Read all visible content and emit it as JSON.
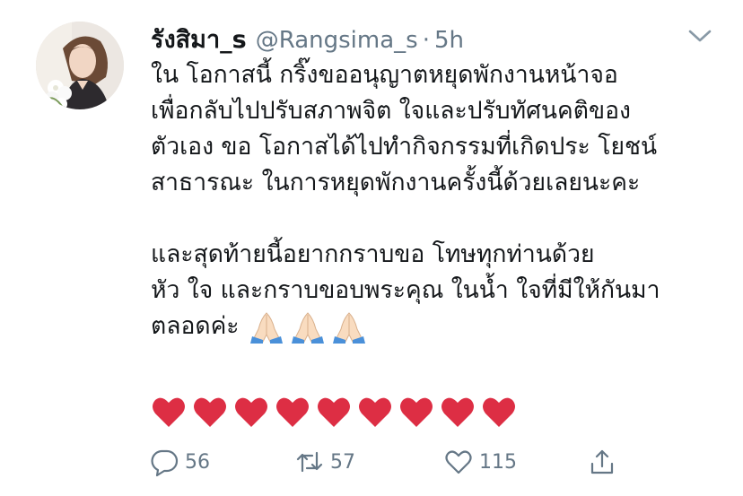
{
  "tweet": {
    "display_name": "รังสิมา_s",
    "handle": "@Rangsima_s",
    "separator": "·",
    "time": "5h",
    "lines": [
      "ใน โอกาสนี้ กริ๊งขออนุญาตหยุดพักงานหน้าจอ",
      "เพื่อกลับไปปรับสภาพจิต ใจและปรับทัศนคติของ",
      "ตัวเอง ขอ โอกาสได้ไปทำกิจกรรมที่เกิดประ โยชน์",
      "สาธารณะ ในการหยุดพักงานครั้งนี้ด้วยเลยนะคะ",
      "",
      "และสุดท้ายนี้อยากกราบขอ โทษทุกท่านด้วย",
      "หัว ใจ และกราบขอบพระคุณ ในน้ำ ใจที่มีให้กันมา",
      "ตลอดค่ะ"
    ],
    "emoji": {
      "inline": "folded-hands",
      "inline_count": 3,
      "heart_count": 9
    }
  },
  "actions": {
    "reply_count": "56",
    "retweet_count": "57",
    "like_count": "115"
  },
  "colors": {
    "text": "#14171a",
    "muted": "#657786",
    "heart": "#dd2e44"
  }
}
